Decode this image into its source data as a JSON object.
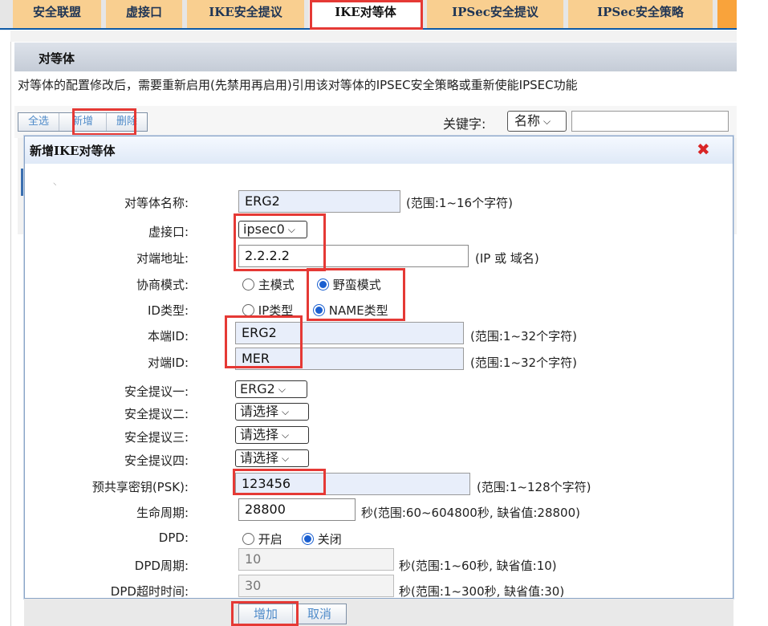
{
  "tabs": [
    {
      "label": "安全联盟",
      "active": false
    },
    {
      "label": "虚接口",
      "active": false
    },
    {
      "label": "IKE安全提议",
      "active": false
    },
    {
      "label": "IKE对等体",
      "active": true
    },
    {
      "label": "IPSec安全提议",
      "active": false
    },
    {
      "label": "IPSec安全策略",
      "active": false
    }
  ],
  "section": {
    "title": "对等体",
    "notice": "对等体的配置修改后，需要重新启用(先禁用再启用)引用该对等体的IPSEC安全策略或重新使能IPSEC功能"
  },
  "toolbar": {
    "select_all": "全选",
    "add": "新增",
    "delete": "删除",
    "keyword_label": "关键字:",
    "keyword_field": "名称"
  },
  "dialog": {
    "title": "新增IKE对等体",
    "fields": {
      "peer_name": {
        "label": "对等体名称:",
        "value": "ERG2",
        "hint": "(范围:1~16个字符)"
      },
      "virtual_if": {
        "label": "虚接口:",
        "value": "ipsec0"
      },
      "remote_addr": {
        "label": "对端地址:",
        "value": "2.2.2.2",
        "hint": "(IP 或 域名)"
      },
      "nego_mode": {
        "label": "协商模式:",
        "opt_main": "主模式",
        "opt_aggr": "野蛮模式",
        "selected": "野蛮模式"
      },
      "id_type": {
        "label": "ID类型:",
        "opt_ip": "IP类型",
        "opt_name": "NAME类型",
        "selected": "NAME类型"
      },
      "local_id": {
        "label": "本端ID:",
        "value": "ERG2",
        "hint": "(范围:1~32个字符)"
      },
      "remote_id": {
        "label": "对端ID:",
        "value": "MER",
        "hint": "(范围:1~32个字符)"
      },
      "proposal1": {
        "label": "安全提议一:",
        "value": "ERG2"
      },
      "proposal2": {
        "label": "安全提议二:",
        "value": "请选择"
      },
      "proposal3": {
        "label": "安全提议三:",
        "value": "请选择"
      },
      "proposal4": {
        "label": "安全提议四:",
        "value": "请选择"
      },
      "psk": {
        "label": "预共享密钥(PSK):",
        "value": "123456",
        "hint": "(范围:1~128个字符)"
      },
      "lifetime": {
        "label": "生命周期:",
        "value": "28800",
        "hint": "秒(范围:60~604800秒, 缺省值:28800)"
      },
      "dpd": {
        "label": "DPD:",
        "opt_on": "开启",
        "opt_off": "关闭",
        "selected": "关闭"
      },
      "dpd_period": {
        "label": "DPD周期:",
        "value": "10",
        "hint": "秒(范围:1~60秒, 缺省值:10)"
      },
      "dpd_timeout": {
        "label": "DPD超时时间:",
        "value": "30",
        "hint": "秒(范围:1~300秒, 缺省值:30)"
      }
    },
    "add_button": "增加",
    "cancel_button": "取消"
  },
  "colors": {
    "tab_bg": "#f9cf90",
    "highlight": "#e53935",
    "radio_on": "#1a5fd0",
    "link_blue": "#4f8bc9"
  },
  "icons": {
    "close": "close-icon",
    "chevron": "chevron-down-icon"
  }
}
